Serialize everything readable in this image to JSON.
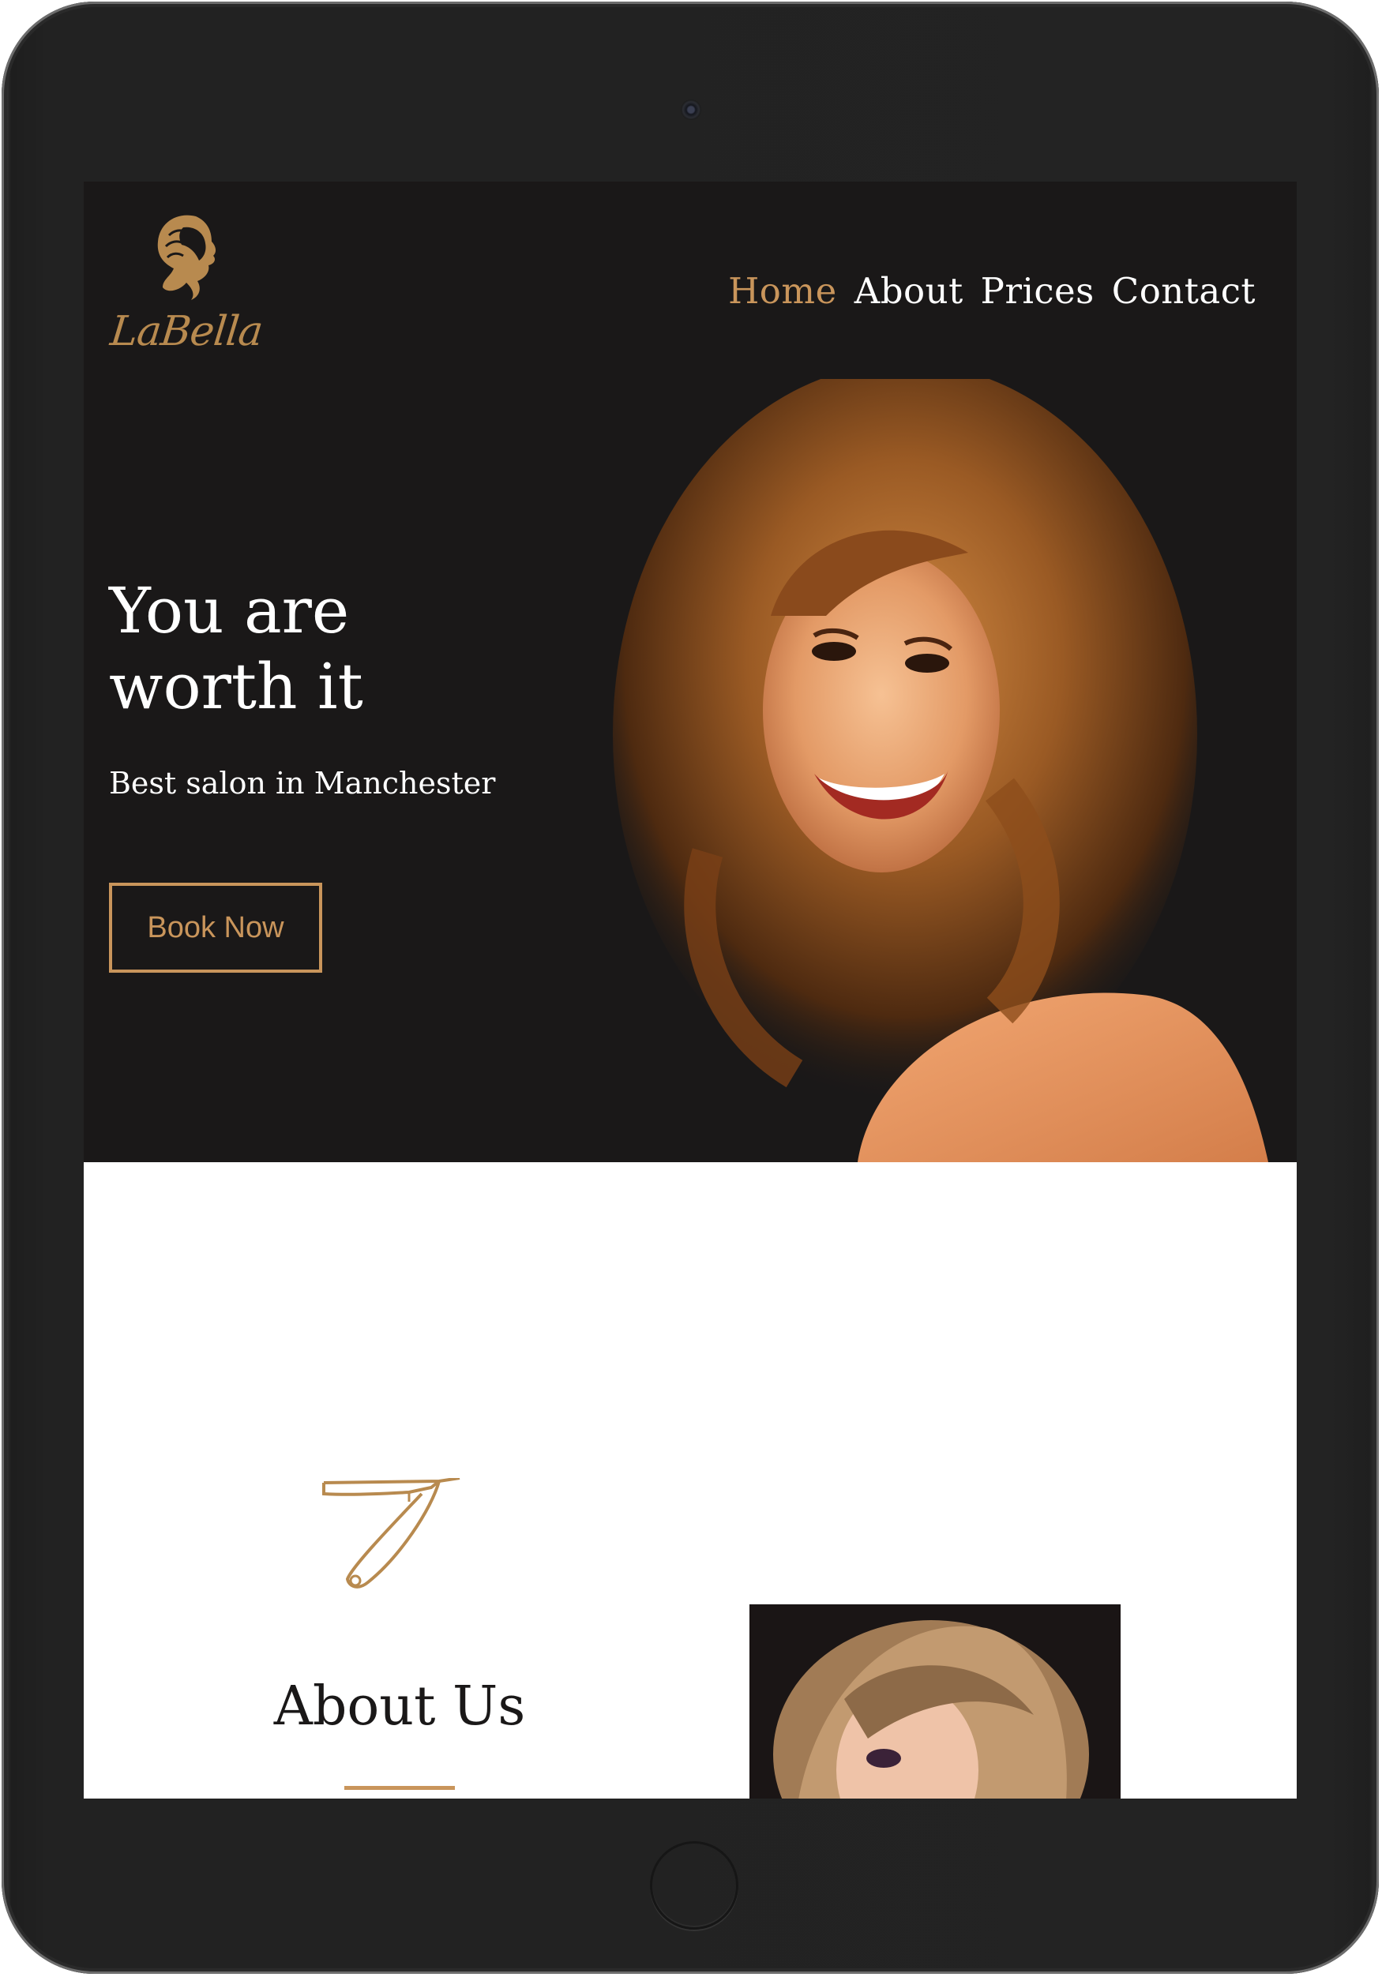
{
  "brand": {
    "name": "LaBella"
  },
  "nav": {
    "items": [
      {
        "label": "Home",
        "active": true
      },
      {
        "label": "About",
        "active": false
      },
      {
        "label": "Prices",
        "active": false
      },
      {
        "label": "Contact",
        "active": false
      }
    ]
  },
  "hero": {
    "title": "You are worth it",
    "subtitle": "Best salon in Manchester",
    "cta_label": "Book Now"
  },
  "about": {
    "title": "About Us",
    "icon": "straight-razor-icon"
  },
  "colors": {
    "accent": "#c9955b",
    "hero_bg": "#1a1818",
    "frame": "#232323"
  }
}
